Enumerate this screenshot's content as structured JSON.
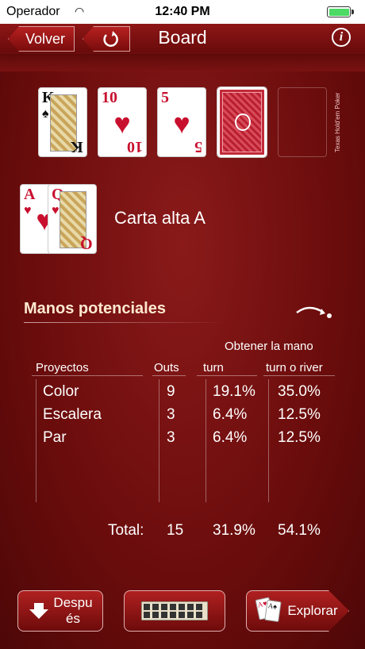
{
  "status": {
    "carrier": "Operador",
    "time": "12:40 PM"
  },
  "nav": {
    "back_label": "Volver",
    "title": "Board",
    "info_label": "i"
  },
  "board": {
    "brand": "Texas Hold'em Poker",
    "cards": [
      {
        "rank": "K",
        "suit": "♠",
        "color": "black"
      },
      {
        "rank": "10",
        "suit": "♥",
        "color": "red"
      },
      {
        "rank": "5",
        "suit": "♥",
        "color": "red"
      }
    ]
  },
  "hand": {
    "cards": [
      {
        "rank": "A",
        "suit": "♥"
      },
      {
        "rank": "Q",
        "suit": "♥"
      }
    ],
    "label": "Carta alta A"
  },
  "potential": {
    "title": "Manos potenciales",
    "obtain_label": "Obtener la mano",
    "headers": {
      "projects": "Proyectos",
      "outs": "Outs",
      "turn": "turn",
      "turn_river": "turn o river"
    },
    "rows": [
      {
        "name": "Color",
        "outs": "9",
        "turn": "19.1%",
        "river": "35.0%"
      },
      {
        "name": "Escalera",
        "outs": "3",
        "turn": "6.4%",
        "river": "12.5%"
      },
      {
        "name": "Par",
        "outs": "3",
        "turn": "6.4%",
        "river": "12.5%"
      }
    ],
    "total": {
      "label": "Total:",
      "outs": "15",
      "turn": "31.9%",
      "river": "54.1%"
    }
  },
  "bottom": {
    "after_label": "Despu\nés",
    "explore_label": "Explorar"
  }
}
